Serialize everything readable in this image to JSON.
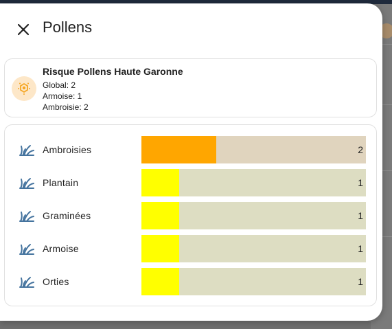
{
  "dialog": {
    "title": "Pollens",
    "close_icon": "close-icon"
  },
  "summary": {
    "icon": "pollen-icon",
    "title": "Risque Pollens Haute Garonne",
    "lines": [
      "Global: 2",
      "Armoise: 1",
      "Ambroisie: 2"
    ]
  },
  "colors": {
    "level_2": "#ffa600",
    "level_1": "#ffff00",
    "track_level_2": "#e0d4be",
    "track_level_1": "#ddddc2",
    "icon": "#44739e"
  },
  "chart_data": {
    "type": "bar",
    "orientation": "horizontal",
    "categories": [
      "Ambroisies",
      "Plantain",
      "Graminées",
      "Armoise",
      "Orties"
    ],
    "values": [
      2,
      1,
      1,
      1,
      1
    ],
    "labels": [
      "2",
      "1",
      "1",
      "1",
      "1"
    ],
    "xlim": [
      0,
      6
    ],
    "icon": "grass-icon"
  }
}
